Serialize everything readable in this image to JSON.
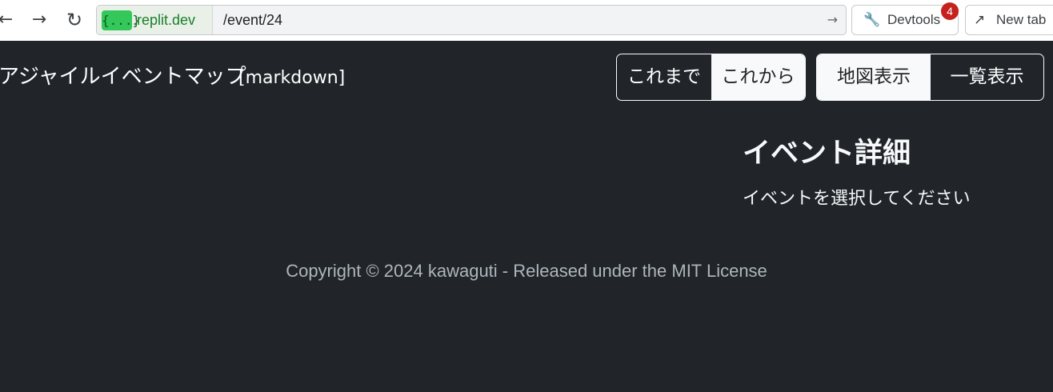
{
  "browser": {
    "back_icon": "arrow-left",
    "forward_icon": "arrow-right",
    "reload_icon": "reload",
    "url_logo_text": "{...}",
    "url_host": ".replit.dev",
    "url_path": "/event/24",
    "go_icon": "arrow-right",
    "devtools_label": "Devtools",
    "devtools_badge": "4",
    "newtab_label": "New tab"
  },
  "header": {
    "title": "アジャイルイベントマップ",
    "subtitle": "[markdown]"
  },
  "filters": {
    "time": [
      {
        "label": "これまで",
        "active": false
      },
      {
        "label": "これから",
        "active": true
      }
    ],
    "view": [
      {
        "label": "地図表示",
        "active": true
      },
      {
        "label": "一覧表示",
        "active": false
      }
    ]
  },
  "detail": {
    "title": "イベント詳細",
    "message": "イベントを選択してください"
  },
  "footer": {
    "text": "Copyright © 2024 kawaguti - Released under the MIT License"
  },
  "colors": {
    "background": "#212529",
    "active_segment": "#f8f9fa",
    "footer_text": "#adb5bd",
    "badge": "#c5221f",
    "url_logo": "#34c759"
  }
}
